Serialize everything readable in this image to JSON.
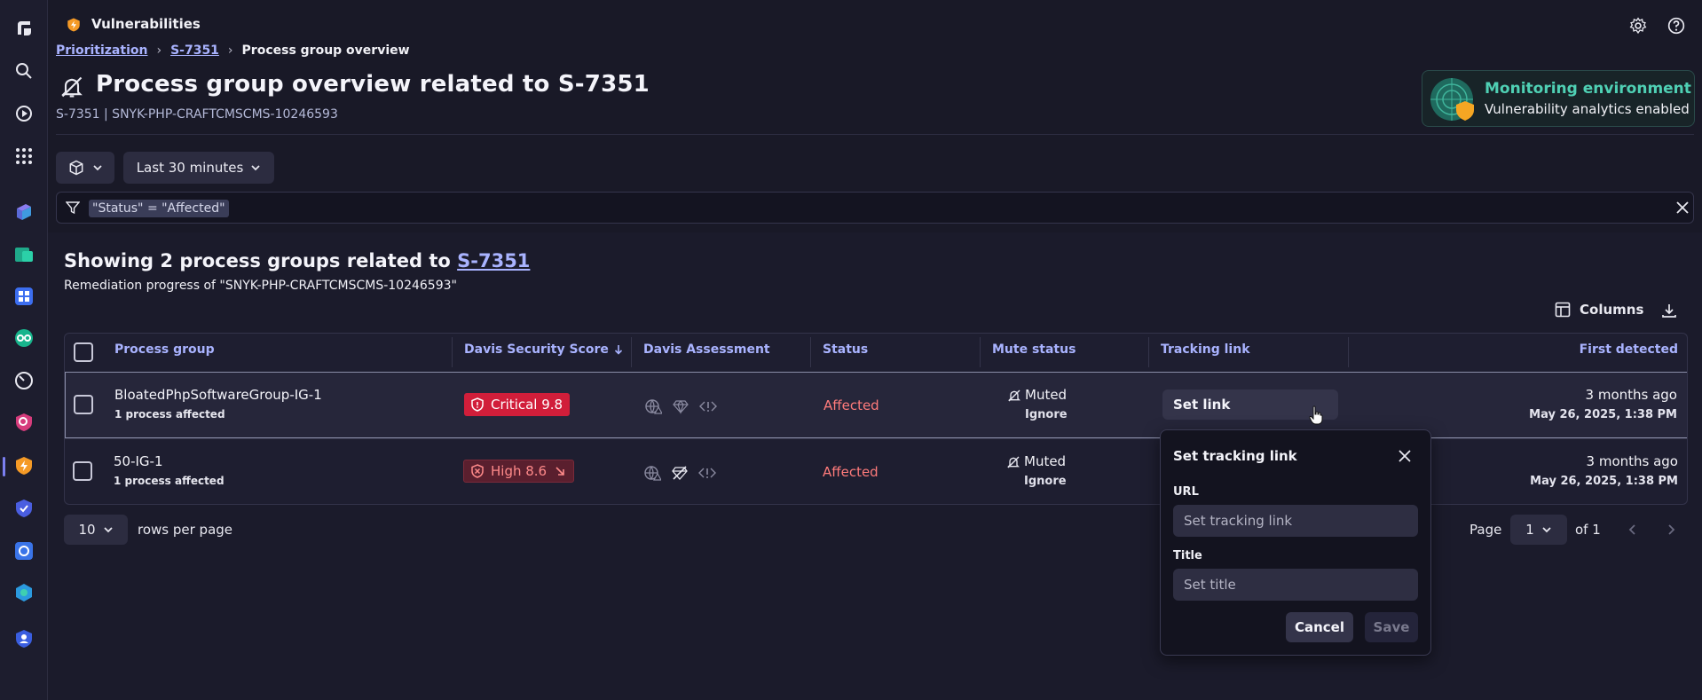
{
  "app": {
    "title": "Vulnerabilities"
  },
  "breadcrumb": {
    "items": [
      "Prioritization",
      "S-7351"
    ],
    "current": "Process group overview",
    "separator": "›"
  },
  "page": {
    "title": "Process group overview related to S-7351",
    "subtitle": "S-7351 | SNYK-PHP-CRAFTCMSCMS-10246593"
  },
  "monitoring": {
    "title": "Monitoring environment",
    "subtitle": "Vulnerability analytics enabled"
  },
  "timeframe": {
    "label": "Last 30 minutes"
  },
  "filter": {
    "token": "\"Status\" = \"Affected\""
  },
  "main": {
    "heading_prefix": "Showing 2 process groups related to",
    "heading_link": "S-7351",
    "subheading": "Remediation progress of \"SNYK-PHP-CRAFTCMSCMS-10246593\"",
    "columns_label": "Columns"
  },
  "table": {
    "headers": {
      "process_group": "Process group",
      "davis_score": "Davis Security Score",
      "assessment": "Davis Assessment",
      "status": "Status",
      "mute_status": "Mute status",
      "tracking_link": "Tracking link",
      "first_detected": "First detected"
    },
    "rows": [
      {
        "name": "BloatedPhpSoftwareGroup-IG-1",
        "sub": "1 process affected",
        "score": "Critical 9.8",
        "status": "Affected",
        "mute": "Muted",
        "mute_reason": "Ignore",
        "tracking": "Set link",
        "detected": "3 months ago",
        "detected_date": "May 26, 2025, 1:38 PM"
      },
      {
        "name": "50-IG-1",
        "sub": "1 process affected",
        "score": "High 8.6",
        "status": "Affected",
        "mute": "Muted",
        "mute_reason": "Ignore",
        "tracking": "",
        "detected": "3 months ago",
        "detected_date": "May 26, 2025, 1:38 PM"
      }
    ],
    "colors": {
      "critical": "#d11e3a",
      "high_bg": "#5a1f2e",
      "high_fg": "#ff8a8a",
      "affected": "#ff7b7b"
    }
  },
  "pager": {
    "rows_value": "10",
    "rows_label": "rows per page",
    "page_label": "Page",
    "page_value": "1",
    "of_label": "of 1"
  },
  "popover": {
    "title": "Set tracking link",
    "url_label": "URL",
    "url_placeholder": "Set tracking link",
    "title_label": "Title",
    "title_placeholder": "Set title",
    "cancel": "Cancel",
    "save": "Save"
  }
}
